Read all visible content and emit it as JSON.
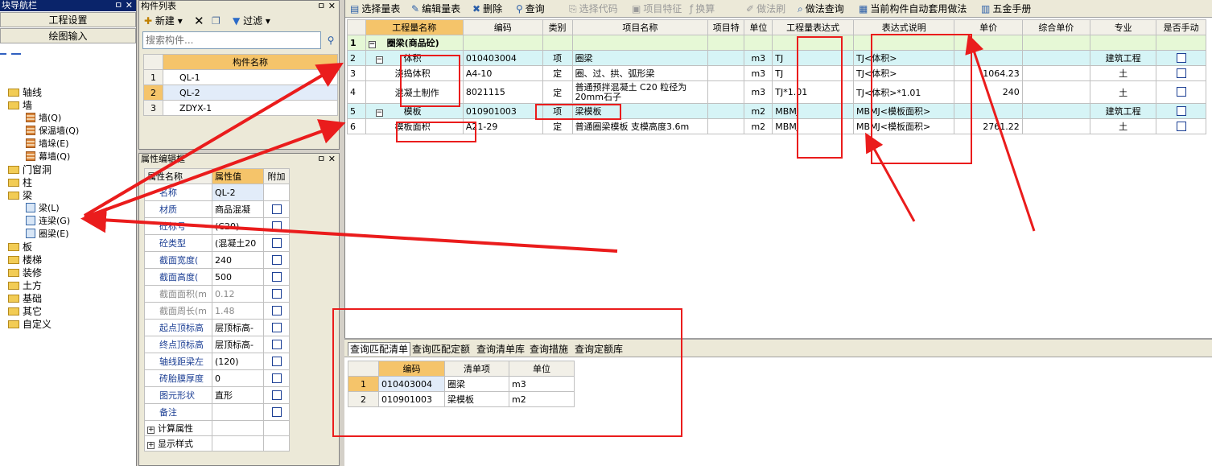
{
  "nav": {
    "title": "块导航栏",
    "pin": "ㅁ ✕",
    "btn_project": "工程设置",
    "btn_drawing": "绘图输入",
    "tree": [
      {
        "label": "轴线",
        "type": "folder"
      },
      {
        "label": "墙",
        "type": "folder"
      },
      {
        "label": "墙(Q)",
        "type": "wall"
      },
      {
        "label": "保温墙(Q)",
        "type": "wall"
      },
      {
        "label": "墙垛(E)",
        "type": "wall"
      },
      {
        "label": "幕墙(Q)",
        "type": "wall"
      },
      {
        "label": "门窗洞",
        "type": "folder"
      },
      {
        "label": "柱",
        "type": "folder"
      },
      {
        "label": "梁",
        "type": "folder"
      },
      {
        "label": "梁(L)",
        "type": "beam"
      },
      {
        "label": "连梁(G)",
        "type": "beam"
      },
      {
        "label": "圈梁(E)",
        "type": "beam"
      },
      {
        "label": "板",
        "type": "folder"
      },
      {
        "label": "楼梯",
        "type": "folder"
      },
      {
        "label": "装修",
        "type": "folder"
      },
      {
        "label": "土方",
        "type": "folder"
      },
      {
        "label": "基础",
        "type": "folder"
      },
      {
        "label": "其它",
        "type": "folder"
      },
      {
        "label": "自定义",
        "type": "folder"
      }
    ]
  },
  "comp": {
    "title": "构件列表",
    "new_label": "新建",
    "filter_label": "过滤",
    "search_placeholder": "搜索构件...",
    "col_name": "构件名称",
    "rows": [
      {
        "n": "1",
        "name": "QL-1"
      },
      {
        "n": "2",
        "name": "QL-2"
      },
      {
        "n": "3",
        "name": "ZDYX-1"
      }
    ]
  },
  "props": {
    "title": "属性编辑框",
    "col_name": "属性名称",
    "col_value": "属性值",
    "col_extra": "附加",
    "rows": [
      {
        "name": "名称",
        "value": "QL-2",
        "cb": false
      },
      {
        "name": "材质",
        "value": "商品混凝",
        "cb": true
      },
      {
        "name": "砼标号",
        "value": "(C20)",
        "cb": true
      },
      {
        "name": "砼类型",
        "value": "(混凝土20",
        "cb": true
      },
      {
        "name": "截面宽度(",
        "value": "240",
        "cb": true
      },
      {
        "name": "截面高度(",
        "value": "500",
        "cb": true
      },
      {
        "name": "截面面积(m",
        "value": "0.12",
        "cb": true,
        "grey": true
      },
      {
        "name": "截面周长(m",
        "value": "1.48",
        "cb": true,
        "grey": true
      },
      {
        "name": "起点顶标高",
        "value": "层顶标高-",
        "cb": true
      },
      {
        "name": "终点顶标高",
        "value": "层顶标高-",
        "cb": true
      },
      {
        "name": "轴线距梁左",
        "value": "(120)",
        "cb": true
      },
      {
        "name": "砖胎膜厚度",
        "value": "0",
        "cb": true
      },
      {
        "name": "图元形状",
        "value": "直形",
        "cb": true
      },
      {
        "name": "备注",
        "value": "",
        "cb": true
      }
    ],
    "group1": "计算属性",
    "group2": "显示样式"
  },
  "main": {
    "toolbar": [
      {
        "label": "选择量表",
        "dis": false
      },
      {
        "label": "编辑量表",
        "dis": false
      },
      {
        "label": "删除",
        "dis": false
      },
      {
        "label": "查询",
        "dis": false
      },
      {
        "label": "选择代码",
        "dis": true
      },
      {
        "label": "项目特征",
        "dis": true
      },
      {
        "label": "换算",
        "dis": true
      },
      {
        "label": "做法刷",
        "dis": true
      },
      {
        "label": "做法查询",
        "dis": false
      },
      {
        "label": "当前构件自动套用做法",
        "dis": false
      },
      {
        "label": "五金手册",
        "dis": false
      }
    ],
    "headers": [
      "工程量名称",
      "编码",
      "类别",
      "项目名称",
      "项目特",
      "单位",
      "工程量表达式",
      "表达式说明",
      "单价",
      "综合单价",
      "专业",
      "是否手动"
    ],
    "rows": [
      {
        "n": "1",
        "kind": "grp",
        "name": "圈梁(商品砼)",
        "code": "",
        "cat": "",
        "proj": "",
        "unit": "",
        "expr": "",
        "desc": "",
        "price": "",
        "major": "",
        "cb": false
      },
      {
        "n": "2",
        "kind": "cyan",
        "name": "体积",
        "code": "010403004",
        "cat": "项",
        "proj": "圈梁",
        "unit": "m3",
        "expr": "TJ",
        "desc": "TJ<体积>",
        "price": "",
        "major": "建筑工程",
        "cb": true
      },
      {
        "n": "3",
        "kind": "row",
        "name": "浇捣体积",
        "code": "A4-10",
        "cat": "定",
        "proj": "圈、过、拱、弧形梁",
        "unit": "m3",
        "expr": "TJ",
        "desc": "TJ<体积>",
        "price": "1064.23",
        "major": "土",
        "cb": true
      },
      {
        "n": "4",
        "kind": "row",
        "name": "混凝土制作",
        "code": "8021115",
        "cat": "定",
        "proj": "普通预拌混凝土 C20 粒径为20mm石子",
        "unit": "m3",
        "expr": "TJ*1.01",
        "desc": "TJ<体积>*1.01",
        "price": "240",
        "major": "土",
        "cb": true
      },
      {
        "n": "5",
        "kind": "cyan",
        "name": "模板",
        "code": "010901003",
        "cat": "项",
        "proj": "梁模板",
        "unit": "m2",
        "expr": "MBMJ",
        "desc": "MBMJ<模板面积>",
        "price": "",
        "major": "建筑工程",
        "cb": true
      },
      {
        "n": "6",
        "kind": "row",
        "name": "模板面积",
        "code": "A21-29",
        "cat": "定",
        "proj": "普通圈梁模板 支模高度3.6m",
        "unit": "m2",
        "expr": "MBMJ",
        "desc": "MBMJ<模板面积>",
        "price": "2761.22",
        "major": "土",
        "cb": true
      }
    ]
  },
  "bottom": {
    "tabs": [
      "查询匹配清单",
      "查询匹配定额",
      "查询清单库",
      "查询措施",
      "查询定额库"
    ],
    "headers": [
      "编码",
      "清单项",
      "单位"
    ],
    "rows": [
      {
        "n": "1",
        "code": "010403004",
        "item": "圈梁",
        "unit": "m3"
      },
      {
        "n": "2",
        "code": "010901003",
        "item": "梁模板",
        "unit": "m2"
      }
    ]
  },
  "colors": {
    "annotation": "#ea1c1c",
    "selected_header": "#f5c46a",
    "group_row": "#e6f8d6",
    "item_row": "#d6f4f6"
  }
}
